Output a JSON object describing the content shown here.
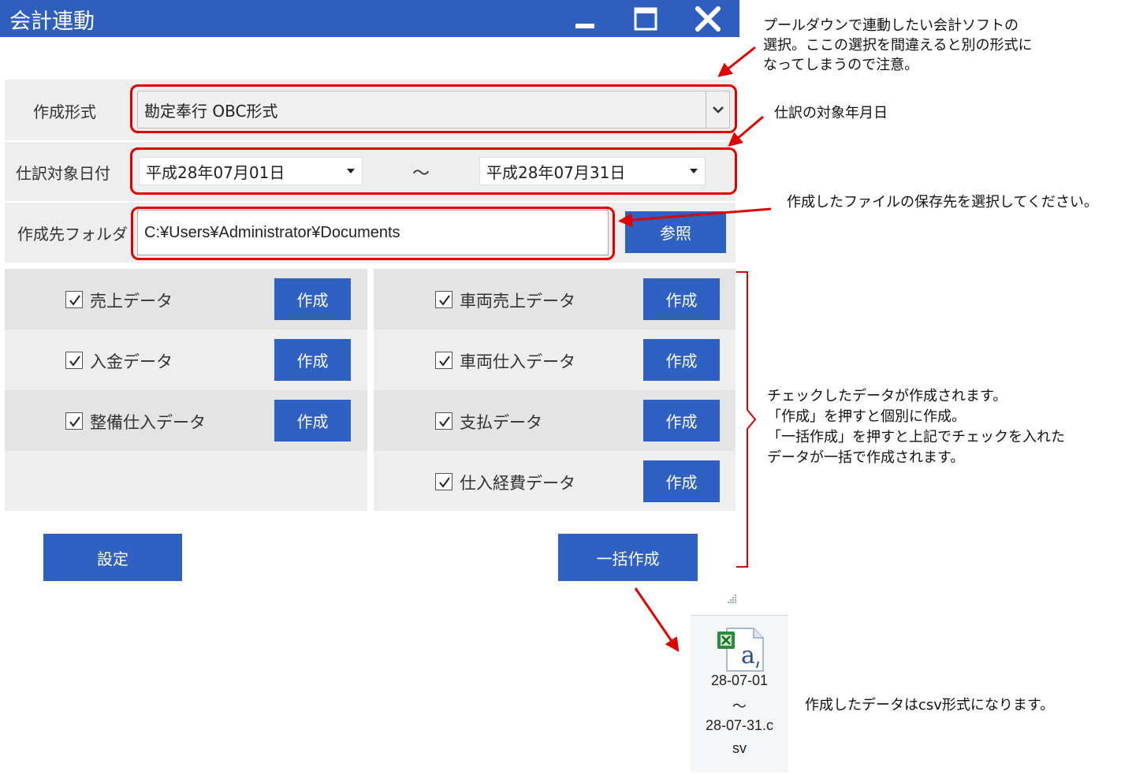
{
  "window": {
    "title": "会計連動",
    "minimize_icon": "minimize-icon",
    "maximize_icon": "maximize-icon",
    "close_icon": "close-icon"
  },
  "form": {
    "format_label": "作成形式",
    "format_value": "勘定奉行 OBC形式",
    "date_label": "仕訳対象日付",
    "date_from": "平成28年07月01日",
    "date_separator": "～",
    "date_to": "平成28年07月31日",
    "folder_label": "作成先フォルダ",
    "folder_value": "C:¥Users¥Administrator¥Documents",
    "browse_button": "参照"
  },
  "left_items": [
    {
      "label": "売上データ",
      "checked": true,
      "button": "作成"
    },
    {
      "label": "入金データ",
      "checked": true,
      "button": "作成"
    },
    {
      "label": "整備仕入データ",
      "checked": true,
      "button": "作成"
    }
  ],
  "right_items": [
    {
      "label": "車両売上データ",
      "checked": true,
      "button": "作成"
    },
    {
      "label": "車両仕入データ",
      "checked": true,
      "button": "作成"
    },
    {
      "label": "支払データ",
      "checked": true,
      "button": "作成"
    },
    {
      "label": "仕入経費データ",
      "checked": true,
      "button": "作成"
    }
  ],
  "footer": {
    "settings_button": "設定",
    "batch_button": "一括作成"
  },
  "annotations": {
    "note1": [
      "プールダウンで連動したい会計ソフトの",
      "選択。ここの選択を間違えると別の形式に",
      "なってしまうので注意。"
    ],
    "note2": "仕訳の対象年月日",
    "note3": "作成したファイルの保存先を選択してください。",
    "note4": [
      "チェックしたデータが作成されます。",
      "「作成」を押すと個別に作成。",
      "「一括作成」を押すと上記でチェックを入れた",
      "データが一括で作成されます。"
    ],
    "note5": "作成したデータはcsv形式になります。"
  },
  "file": {
    "icon": "excel-csv-file-icon",
    "name_lines": [
      "28-07-01",
      "～",
      "28-07-31.c",
      "sv"
    ]
  },
  "colors": {
    "titlebar": "#2f5fbe",
    "button": "#2f61c2",
    "highlight": "#e00000"
  }
}
